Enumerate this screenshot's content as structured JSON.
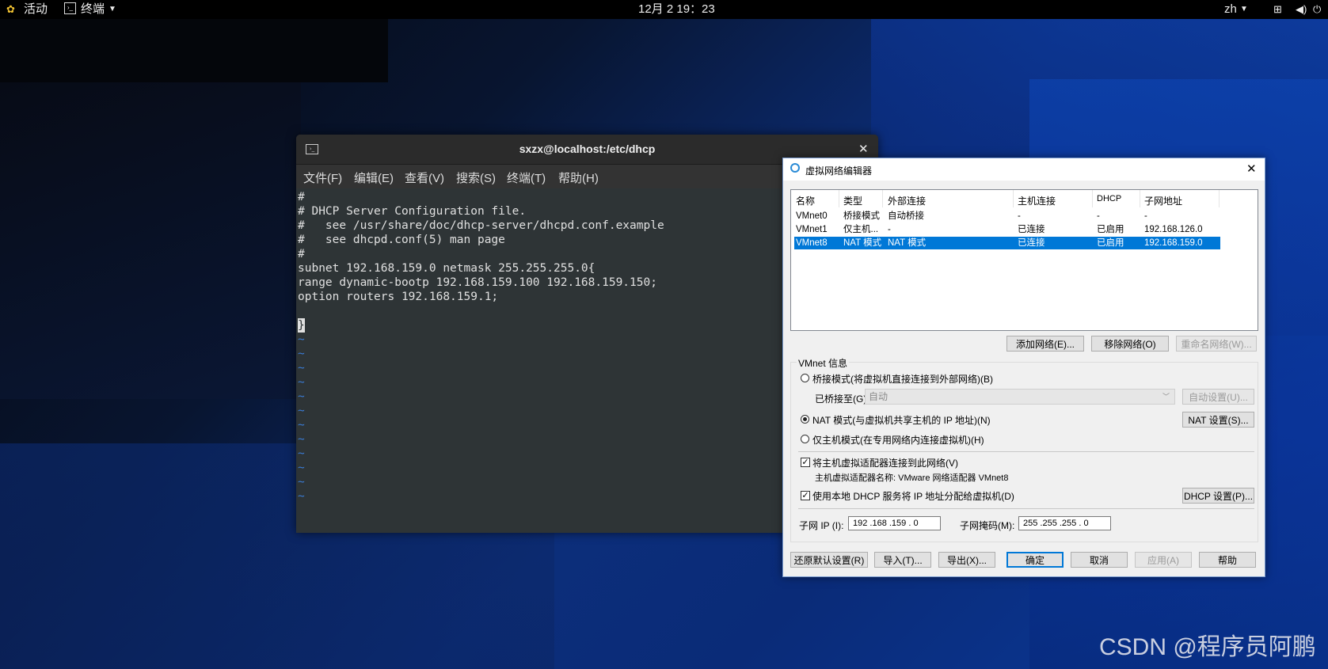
{
  "topbar": {
    "activities": "活动",
    "app": "终端",
    "clock": "12月 2  19：23",
    "lang": "zh"
  },
  "terminal": {
    "title": "sxzx@localhost:/etc/dhcp",
    "menu": [
      "文件(F)",
      "编辑(E)",
      "查看(V)",
      "搜索(S)",
      "终端(T)",
      "帮助(H)"
    ],
    "lines": [
      "#",
      "# DHCP Server Configuration file.",
      "#   see /usr/share/doc/dhcp-server/dhcpd.conf.example",
      "#   see dhcpd.conf(5) man page",
      "#",
      "subnet 192.168.159.0 netmask 255.255.255.0{",
      "range dynamic-bootp 192.168.159.100 192.168.159.150;",
      "option routers 192.168.159.1;",
      "",
      "}"
    ],
    "tilde": "~"
  },
  "dialog": {
    "title": "虚拟网络编辑器",
    "columns": [
      "名称",
      "类型",
      "外部连接",
      "主机连接",
      "DHCP",
      "子网地址"
    ],
    "rows": [
      {
        "name": "VMnet0",
        "type": "桥接模式",
        "external": "自动桥接",
        "host": "-",
        "dhcp": "-",
        "subnet": "-"
      },
      {
        "name": "VMnet1",
        "type": "仅主机...",
        "external": "-",
        "host": "已连接",
        "dhcp": "已启用",
        "subnet": "192.168.126.0"
      },
      {
        "name": "VMnet8",
        "type": "NAT 模式",
        "external": "NAT 模式",
        "host": "已连接",
        "dhcp": "已启用",
        "subnet": "192.168.159.0"
      }
    ],
    "add_network": "添加网络(E)...",
    "remove_network": "移除网络(O)",
    "rename_network": "重命名网络(W)...",
    "vmnet_info": "VMnet 信息",
    "bridge_mode": "桥接模式(将虚拟机直接连接到外部网络)(B)",
    "bridged_to": "已桥接至(G):",
    "bridged_value": "自动",
    "auto_settings": "自动设置(U)...",
    "nat_mode": "NAT 模式(与虚拟机共享主机的 IP 地址)(N)",
    "nat_settings": "NAT 设置(S)...",
    "host_only": "仅主机模式(在专用网络内连接虚拟机)(H)",
    "connect_adapter": "将主机虚拟适配器连接到此网络(V)",
    "adapter_name": "主机虚拟适配器名称: VMware 网络适配器 VMnet8",
    "use_dhcp": "使用本地 DHCP 服务将 IP 地址分配给虚拟机(D)",
    "dhcp_settings": "DHCP 设置(P)...",
    "subnet_ip_label": "子网 IP (I):",
    "subnet_ip": "192 .168 .159 .  0",
    "mask_label": "子网掩码(M):",
    "mask": "255 .255 .255 .  0",
    "restore": "还原默认设置(R)",
    "import": "导入(T)...",
    "export": "导出(X)...",
    "ok": "确定",
    "cancel": "取消",
    "apply": "应用(A)",
    "help": "帮助"
  },
  "watermark": "CSDN @程序员阿鹏"
}
